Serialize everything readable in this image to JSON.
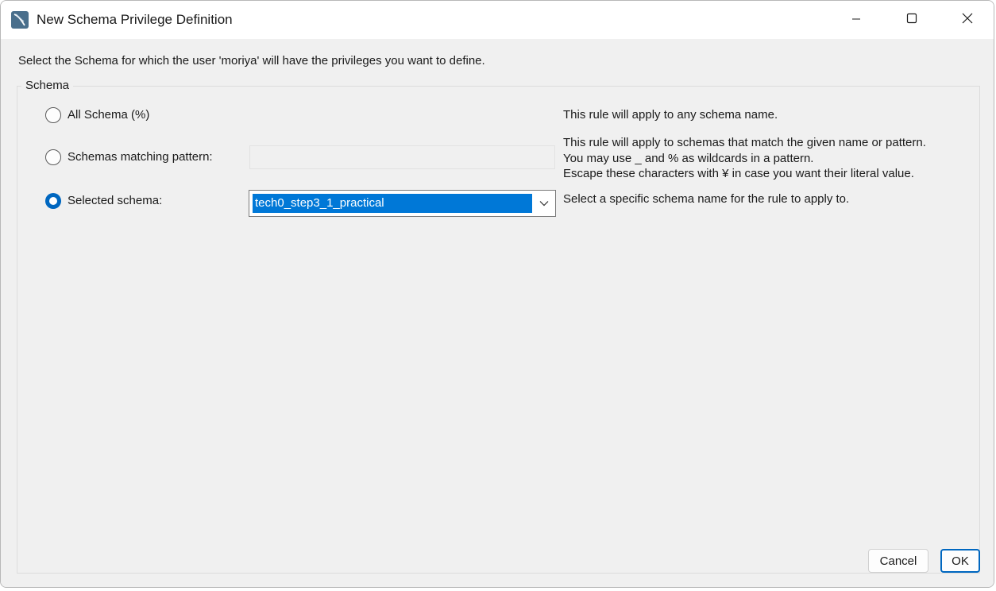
{
  "window": {
    "title": "New Schema Privilege Definition"
  },
  "dialog": {
    "instruction": "Select the Schema for which the user 'moriya' will have the privileges you want to define.",
    "group_label": "Schema",
    "options": [
      {
        "label": "All Schema (%)",
        "checked": false,
        "description": [
          "This rule will apply to any schema name."
        ]
      },
      {
        "label": "Schemas matching pattern:",
        "checked": false,
        "input_value": "",
        "description": [
          "This rule will apply to schemas that match the given name or pattern.",
          "You may use _ and % as wildcards in a pattern.",
          "Escape these characters with ¥ in case you want their literal value."
        ]
      },
      {
        "label": "Selected schema:",
        "checked": true,
        "selected_value": "tech0_step3_1_practical",
        "description": [
          "Select a specific schema name for the rule to apply to."
        ]
      }
    ],
    "buttons": {
      "cancel": "Cancel",
      "ok": "OK"
    }
  },
  "icons": {
    "app": "mysql-workbench-icon",
    "minimize": "minimize-icon",
    "maximize": "maximize-icon",
    "close": "close-icon",
    "dropdown": "chevron-down-icon"
  },
  "colors": {
    "accent": "#0067c0",
    "selection": "#0078d7",
    "background": "#f0f0f0"
  }
}
